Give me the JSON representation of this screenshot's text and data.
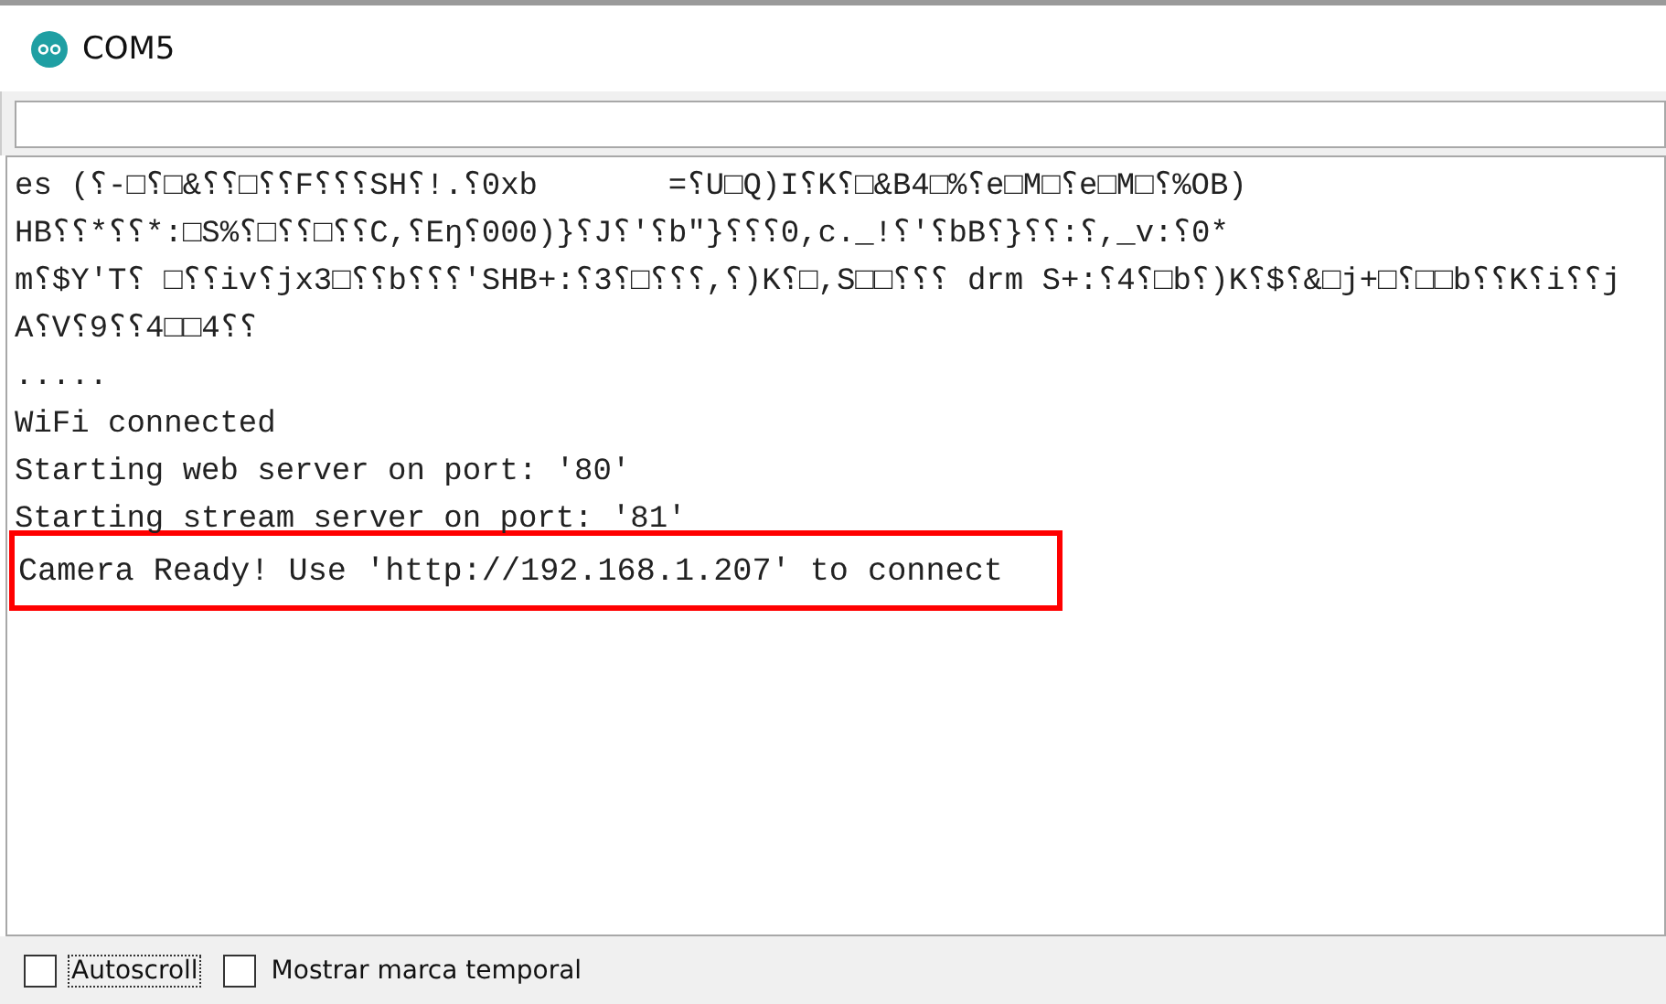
{
  "window": {
    "title": "COM5"
  },
  "output_lines": [
    {
      "text": "es (⸮-□⸮□&⸮⸮□⸮⸮F⸮⸮⸮SH⸮!.⸮0xb       =⸮U□Q)I⸮K⸮□&B4□%⸮e□M□⸮e□M□⸮%OB)",
      "highlighted": false
    },
    {
      "text": "HB⸮⸮*⸮⸮*:□S%⸮□⸮⸮□⸮⸮C,⸮Eŋ⸮000)}⸮J⸮'⸮b\"}⸮⸮⸮0,c._!⸮'⸮bB⸮}⸮⸮:⸮,_v:⸮0*",
      "highlighted": false
    },
    {
      "text": "m⸮$Y'T⸮ □⸮⸮iv⸮jx3□⸮⸮b⸮⸮⸮'SHB+:⸮3⸮□⸮⸮⸮,⸮)K⸮□,S□□⸮⸮⸮ drm S+:⸮4⸮□b⸮)K⸮$⸮&□j+□⸮□□b⸮⸮K⸮i⸮⸮j",
      "highlighted": false
    },
    {
      "text": "A⸮V⸮9⸮⸮4□□4⸮⸮",
      "highlighted": false
    },
    {
      "text": ".....",
      "highlighted": false
    },
    {
      "text": "WiFi connected",
      "highlighted": false
    },
    {
      "text": "Starting web server on port: '80'",
      "highlighted": false
    },
    {
      "text": "Starting stream server on port: '81'",
      "highlighted": false
    },
    {
      "text": "Camera Ready! Use 'http://192.168.1.207' to connect",
      "highlighted": true
    }
  ],
  "options": [
    {
      "label": "Autoscroll",
      "checked": false,
      "focused": true
    },
    {
      "label": "Mostrar marca temporal",
      "checked": false,
      "focused": false
    }
  ]
}
